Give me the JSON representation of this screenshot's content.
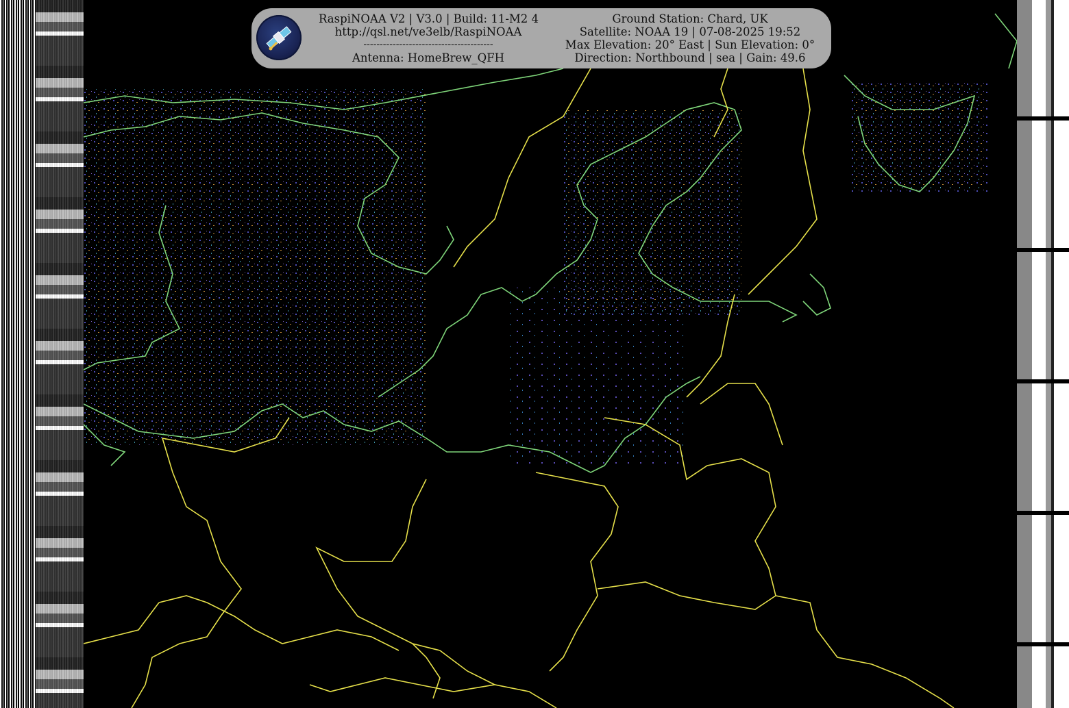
{
  "banner": {
    "app_line": "RaspiNOAA V2 | V3.0 | Build: 11-M2 4",
    "url": "http://qsl.net/ve3elb/RaspiNOAA",
    "separator": "----------------------------------------",
    "antenna": "Antenna: HomeBrew_QFH",
    "ground_station": "Ground Station: Chard, UK",
    "satellite": "Satellite: NOAA 19 | 07-08-2025 19:52",
    "elevation": "Max Elevation: 20° East | Sun Elevation: 0°",
    "direction": "Direction: Northbound | sea | Gain: 49.6"
  },
  "logo": {
    "icon": "satellite-icon"
  },
  "colors": {
    "coastline": "#7fd67a",
    "border": "#e6e04a",
    "banner_bg": "#a9a9a9"
  }
}
